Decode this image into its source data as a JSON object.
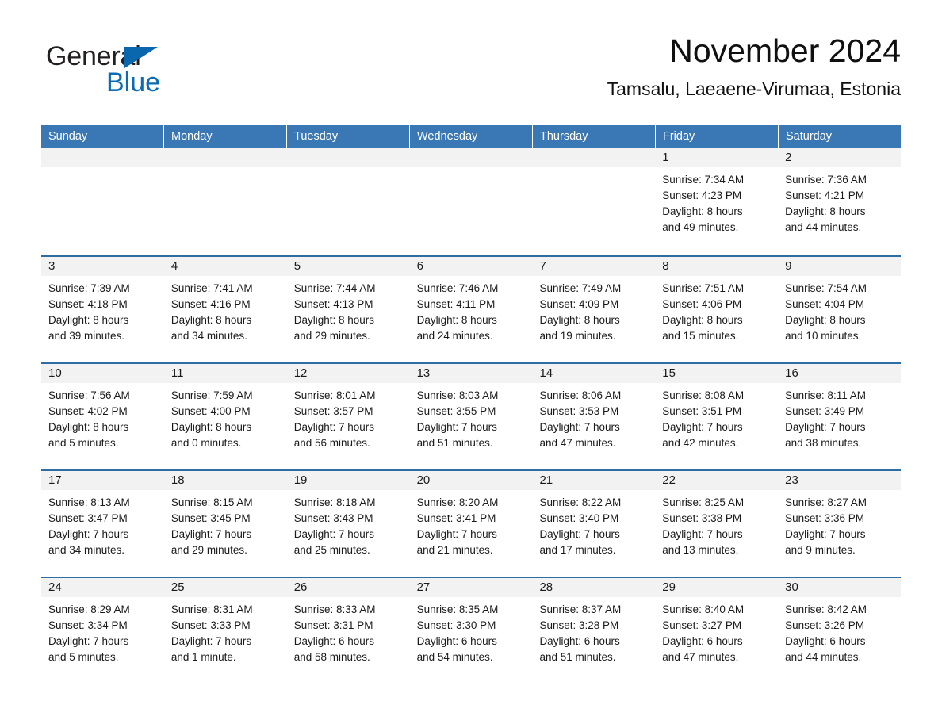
{
  "brand": {
    "name_part1": "General",
    "name_part2": "Blue",
    "accent_color": "#0b6cb5",
    "triangle_color": "#0a66ad"
  },
  "header": {
    "title": "November 2024",
    "location": "Tamsalu, Laeaene-Virumaa, Estonia"
  },
  "calendar": {
    "header_bg": "#3a78b5",
    "row_border_color": "#2d6da4",
    "daynum_bg": "#f2f2f2",
    "weekday_headers": [
      "Sunday",
      "Monday",
      "Tuesday",
      "Wednesday",
      "Thursday",
      "Friday",
      "Saturday"
    ],
    "weeks": [
      [
        {
          "day": "",
          "sunrise": "",
          "sunset": "",
          "daylight_line1": "",
          "daylight_line2": "",
          "empty": true
        },
        {
          "day": "",
          "sunrise": "",
          "sunset": "",
          "daylight_line1": "",
          "daylight_line2": "",
          "empty": true
        },
        {
          "day": "",
          "sunrise": "",
          "sunset": "",
          "daylight_line1": "",
          "daylight_line2": "",
          "empty": true
        },
        {
          "day": "",
          "sunrise": "",
          "sunset": "",
          "daylight_line1": "",
          "daylight_line2": "",
          "empty": true
        },
        {
          "day": "",
          "sunrise": "",
          "sunset": "",
          "daylight_line1": "",
          "daylight_line2": "",
          "empty": true
        },
        {
          "day": "1",
          "sunrise": "Sunrise: 7:34 AM",
          "sunset": "Sunset: 4:23 PM",
          "daylight_line1": "Daylight: 8 hours",
          "daylight_line2": "and 49 minutes.",
          "empty": false
        },
        {
          "day": "2",
          "sunrise": "Sunrise: 7:36 AM",
          "sunset": "Sunset: 4:21 PM",
          "daylight_line1": "Daylight: 8 hours",
          "daylight_line2": "and 44 minutes.",
          "empty": false
        }
      ],
      [
        {
          "day": "3",
          "sunrise": "Sunrise: 7:39 AM",
          "sunset": "Sunset: 4:18 PM",
          "daylight_line1": "Daylight: 8 hours",
          "daylight_line2": "and 39 minutes.",
          "empty": false
        },
        {
          "day": "4",
          "sunrise": "Sunrise: 7:41 AM",
          "sunset": "Sunset: 4:16 PM",
          "daylight_line1": "Daylight: 8 hours",
          "daylight_line2": "and 34 minutes.",
          "empty": false
        },
        {
          "day": "5",
          "sunrise": "Sunrise: 7:44 AM",
          "sunset": "Sunset: 4:13 PM",
          "daylight_line1": "Daylight: 8 hours",
          "daylight_line2": "and 29 minutes.",
          "empty": false
        },
        {
          "day": "6",
          "sunrise": "Sunrise: 7:46 AM",
          "sunset": "Sunset: 4:11 PM",
          "daylight_line1": "Daylight: 8 hours",
          "daylight_line2": "and 24 minutes.",
          "empty": false
        },
        {
          "day": "7",
          "sunrise": "Sunrise: 7:49 AM",
          "sunset": "Sunset: 4:09 PM",
          "daylight_line1": "Daylight: 8 hours",
          "daylight_line2": "and 19 minutes.",
          "empty": false
        },
        {
          "day": "8",
          "sunrise": "Sunrise: 7:51 AM",
          "sunset": "Sunset: 4:06 PM",
          "daylight_line1": "Daylight: 8 hours",
          "daylight_line2": "and 15 minutes.",
          "empty": false
        },
        {
          "day": "9",
          "sunrise": "Sunrise: 7:54 AM",
          "sunset": "Sunset: 4:04 PM",
          "daylight_line1": "Daylight: 8 hours",
          "daylight_line2": "and 10 minutes.",
          "empty": false
        }
      ],
      [
        {
          "day": "10",
          "sunrise": "Sunrise: 7:56 AM",
          "sunset": "Sunset: 4:02 PM",
          "daylight_line1": "Daylight: 8 hours",
          "daylight_line2": "and 5 minutes.",
          "empty": false
        },
        {
          "day": "11",
          "sunrise": "Sunrise: 7:59 AM",
          "sunset": "Sunset: 4:00 PM",
          "daylight_line1": "Daylight: 8 hours",
          "daylight_line2": "and 0 minutes.",
          "empty": false
        },
        {
          "day": "12",
          "sunrise": "Sunrise: 8:01 AM",
          "sunset": "Sunset: 3:57 PM",
          "daylight_line1": "Daylight: 7 hours",
          "daylight_line2": "and 56 minutes.",
          "empty": false
        },
        {
          "day": "13",
          "sunrise": "Sunrise: 8:03 AM",
          "sunset": "Sunset: 3:55 PM",
          "daylight_line1": "Daylight: 7 hours",
          "daylight_line2": "and 51 minutes.",
          "empty": false
        },
        {
          "day": "14",
          "sunrise": "Sunrise: 8:06 AM",
          "sunset": "Sunset: 3:53 PM",
          "daylight_line1": "Daylight: 7 hours",
          "daylight_line2": "and 47 minutes.",
          "empty": false
        },
        {
          "day": "15",
          "sunrise": "Sunrise: 8:08 AM",
          "sunset": "Sunset: 3:51 PM",
          "daylight_line1": "Daylight: 7 hours",
          "daylight_line2": "and 42 minutes.",
          "empty": false
        },
        {
          "day": "16",
          "sunrise": "Sunrise: 8:11 AM",
          "sunset": "Sunset: 3:49 PM",
          "daylight_line1": "Daylight: 7 hours",
          "daylight_line2": "and 38 minutes.",
          "empty": false
        }
      ],
      [
        {
          "day": "17",
          "sunrise": "Sunrise: 8:13 AM",
          "sunset": "Sunset: 3:47 PM",
          "daylight_line1": "Daylight: 7 hours",
          "daylight_line2": "and 34 minutes.",
          "empty": false
        },
        {
          "day": "18",
          "sunrise": "Sunrise: 8:15 AM",
          "sunset": "Sunset: 3:45 PM",
          "daylight_line1": "Daylight: 7 hours",
          "daylight_line2": "and 29 minutes.",
          "empty": false
        },
        {
          "day": "19",
          "sunrise": "Sunrise: 8:18 AM",
          "sunset": "Sunset: 3:43 PM",
          "daylight_line1": "Daylight: 7 hours",
          "daylight_line2": "and 25 minutes.",
          "empty": false
        },
        {
          "day": "20",
          "sunrise": "Sunrise: 8:20 AM",
          "sunset": "Sunset: 3:41 PM",
          "daylight_line1": "Daylight: 7 hours",
          "daylight_line2": "and 21 minutes.",
          "empty": false
        },
        {
          "day": "21",
          "sunrise": "Sunrise: 8:22 AM",
          "sunset": "Sunset: 3:40 PM",
          "daylight_line1": "Daylight: 7 hours",
          "daylight_line2": "and 17 minutes.",
          "empty": false
        },
        {
          "day": "22",
          "sunrise": "Sunrise: 8:25 AM",
          "sunset": "Sunset: 3:38 PM",
          "daylight_line1": "Daylight: 7 hours",
          "daylight_line2": "and 13 minutes.",
          "empty": false
        },
        {
          "day": "23",
          "sunrise": "Sunrise: 8:27 AM",
          "sunset": "Sunset: 3:36 PM",
          "daylight_line1": "Daylight: 7 hours",
          "daylight_line2": "and 9 minutes.",
          "empty": false
        }
      ],
      [
        {
          "day": "24",
          "sunrise": "Sunrise: 8:29 AM",
          "sunset": "Sunset: 3:34 PM",
          "daylight_line1": "Daylight: 7 hours",
          "daylight_line2": "and 5 minutes.",
          "empty": false
        },
        {
          "day": "25",
          "sunrise": "Sunrise: 8:31 AM",
          "sunset": "Sunset: 3:33 PM",
          "daylight_line1": "Daylight: 7 hours",
          "daylight_line2": "and 1 minute.",
          "empty": false
        },
        {
          "day": "26",
          "sunrise": "Sunrise: 8:33 AM",
          "sunset": "Sunset: 3:31 PM",
          "daylight_line1": "Daylight: 6 hours",
          "daylight_line2": "and 58 minutes.",
          "empty": false
        },
        {
          "day": "27",
          "sunrise": "Sunrise: 8:35 AM",
          "sunset": "Sunset: 3:30 PM",
          "daylight_line1": "Daylight: 6 hours",
          "daylight_line2": "and 54 minutes.",
          "empty": false
        },
        {
          "day": "28",
          "sunrise": "Sunrise: 8:37 AM",
          "sunset": "Sunset: 3:28 PM",
          "daylight_line1": "Daylight: 6 hours",
          "daylight_line2": "and 51 minutes.",
          "empty": false
        },
        {
          "day": "29",
          "sunrise": "Sunrise: 8:40 AM",
          "sunset": "Sunset: 3:27 PM",
          "daylight_line1": "Daylight: 6 hours",
          "daylight_line2": "and 47 minutes.",
          "empty": false
        },
        {
          "day": "30",
          "sunrise": "Sunrise: 8:42 AM",
          "sunset": "Sunset: 3:26 PM",
          "daylight_line1": "Daylight: 6 hours",
          "daylight_line2": "and 44 minutes.",
          "empty": false
        }
      ]
    ]
  }
}
